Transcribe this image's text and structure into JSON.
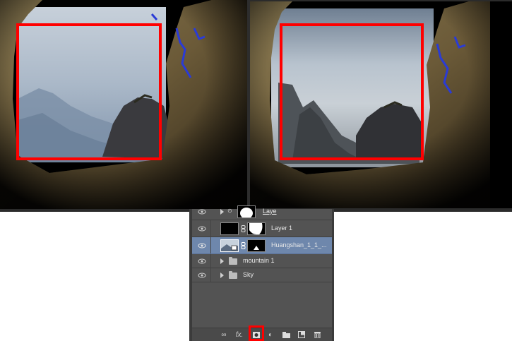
{
  "canvases": {
    "before": {
      "name": "before-canvas"
    },
    "after": {
      "name": "after-canvas"
    },
    "highlight_color": "#ff0000"
  },
  "layers_panel": {
    "rows": [
      {
        "name": "Laye",
        "visible": true,
        "kind": "group-masked"
      },
      {
        "name": "Layer 1",
        "visible": true,
        "kind": "layer-masked"
      },
      {
        "name": "Huangshan_1_1_...",
        "visible": true,
        "kind": "smart-object-masked",
        "selected": true
      },
      {
        "name": "mountain 1",
        "visible": true,
        "kind": "group"
      },
      {
        "name": "Sky",
        "visible": true,
        "kind": "group"
      }
    ],
    "footer_buttons": [
      {
        "icon": "link-icon",
        "label": "∞"
      },
      {
        "icon": "fx-icon",
        "label": "fx."
      },
      {
        "icon": "add-mask-icon",
        "label": "◘"
      },
      {
        "icon": "adjustment-icon",
        "label": "◐"
      },
      {
        "icon": "folder-icon",
        "label": "▆"
      },
      {
        "icon": "new-layer-icon",
        "label": "▣"
      },
      {
        "icon": "trash-icon",
        "label": "🗑"
      }
    ],
    "selected_color": "#6e87ac"
  }
}
